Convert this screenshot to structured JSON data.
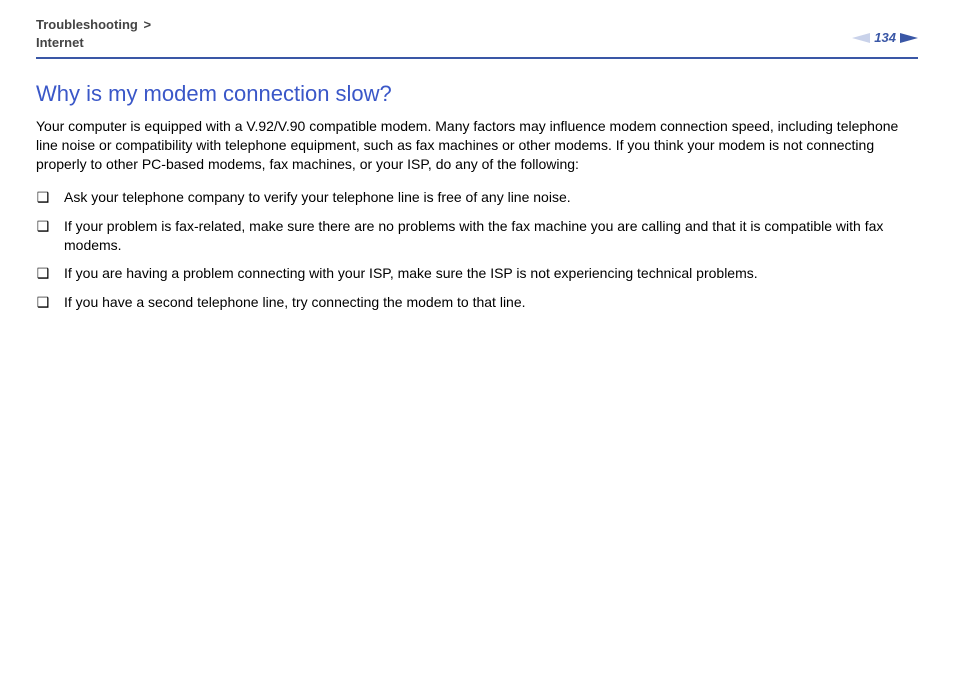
{
  "header": {
    "breadcrumb_section": "Troubleshooting",
    "breadcrumb_sep": ">",
    "breadcrumb_sub": "Internet",
    "page_number": "134"
  },
  "content": {
    "title": "Why is my modem connection slow?",
    "intro": "Your computer is equipped with a V.92/V.90 compatible modem. Many factors may influence modem connection speed, including telephone line noise or compatibility with telephone equipment, such as fax machines or other modems. If you think your modem is not connecting properly to other PC-based modems, fax machines, or your ISP, do any of the following:",
    "bullets": [
      "Ask your telephone company to verify your telephone line is free of any line noise.",
      "If your problem is fax-related, make sure there are no problems with the fax machine you are calling and that it is compatible with fax modems.",
      "If you are having a problem connecting with your ISP, make sure the ISP is not experiencing technical problems.",
      "If you have a second telephone line, try connecting the modem to that line."
    ]
  },
  "glyphs": {
    "bullet": "❑"
  }
}
